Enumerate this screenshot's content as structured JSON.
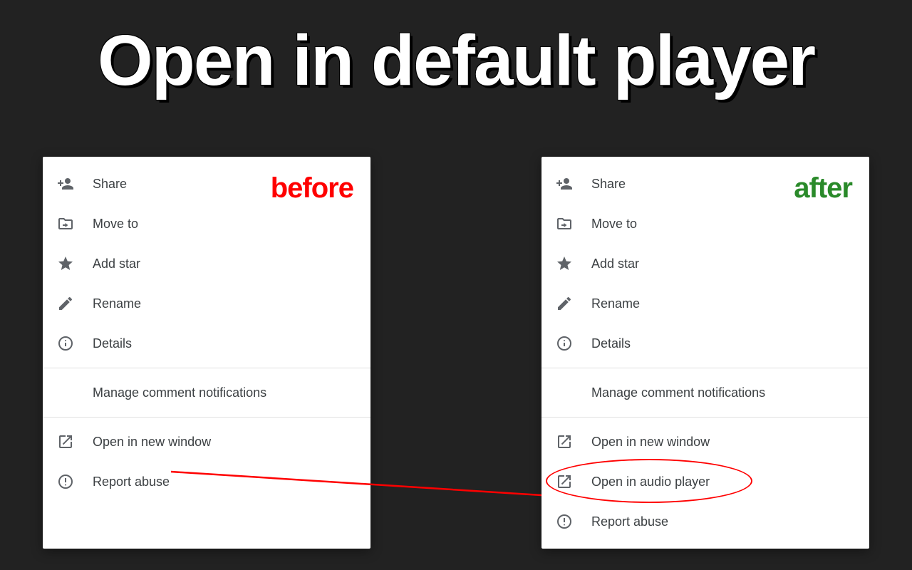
{
  "headline": "Open in default player",
  "labels": {
    "before": "before",
    "after": "after"
  },
  "menu_before": {
    "items": [
      {
        "icon": "person-add-icon",
        "label": "Share"
      },
      {
        "icon": "folder-move-icon",
        "label": "Move to"
      },
      {
        "icon": "star-icon",
        "label": "Add star"
      },
      {
        "icon": "pencil-icon",
        "label": "Rename"
      },
      {
        "icon": "info-icon",
        "label": "Details"
      }
    ],
    "section2": [
      {
        "icon": null,
        "label": "Manage comment notifications"
      }
    ],
    "section3": [
      {
        "icon": "open-new-window-icon",
        "label": "Open in new window"
      },
      {
        "icon": "report-icon",
        "label": "Report abuse"
      }
    ]
  },
  "menu_after": {
    "items": [
      {
        "icon": "person-add-icon",
        "label": "Share"
      },
      {
        "icon": "folder-move-icon",
        "label": "Move to"
      },
      {
        "icon": "star-icon",
        "label": "Add star"
      },
      {
        "icon": "pencil-icon",
        "label": "Rename"
      },
      {
        "icon": "info-icon",
        "label": "Details"
      }
    ],
    "section2": [
      {
        "icon": null,
        "label": "Manage comment notifications"
      }
    ],
    "section3": [
      {
        "icon": "open-new-window-icon",
        "label": "Open in new window"
      },
      {
        "icon": "open-new-window-icon",
        "label": "Open in audio player",
        "highlighted": true
      },
      {
        "icon": "report-icon",
        "label": "Report abuse"
      }
    ]
  },
  "colors": {
    "before_label": "#ff0000",
    "after_label": "#2a8a2a",
    "arrow": "#ff0000"
  }
}
